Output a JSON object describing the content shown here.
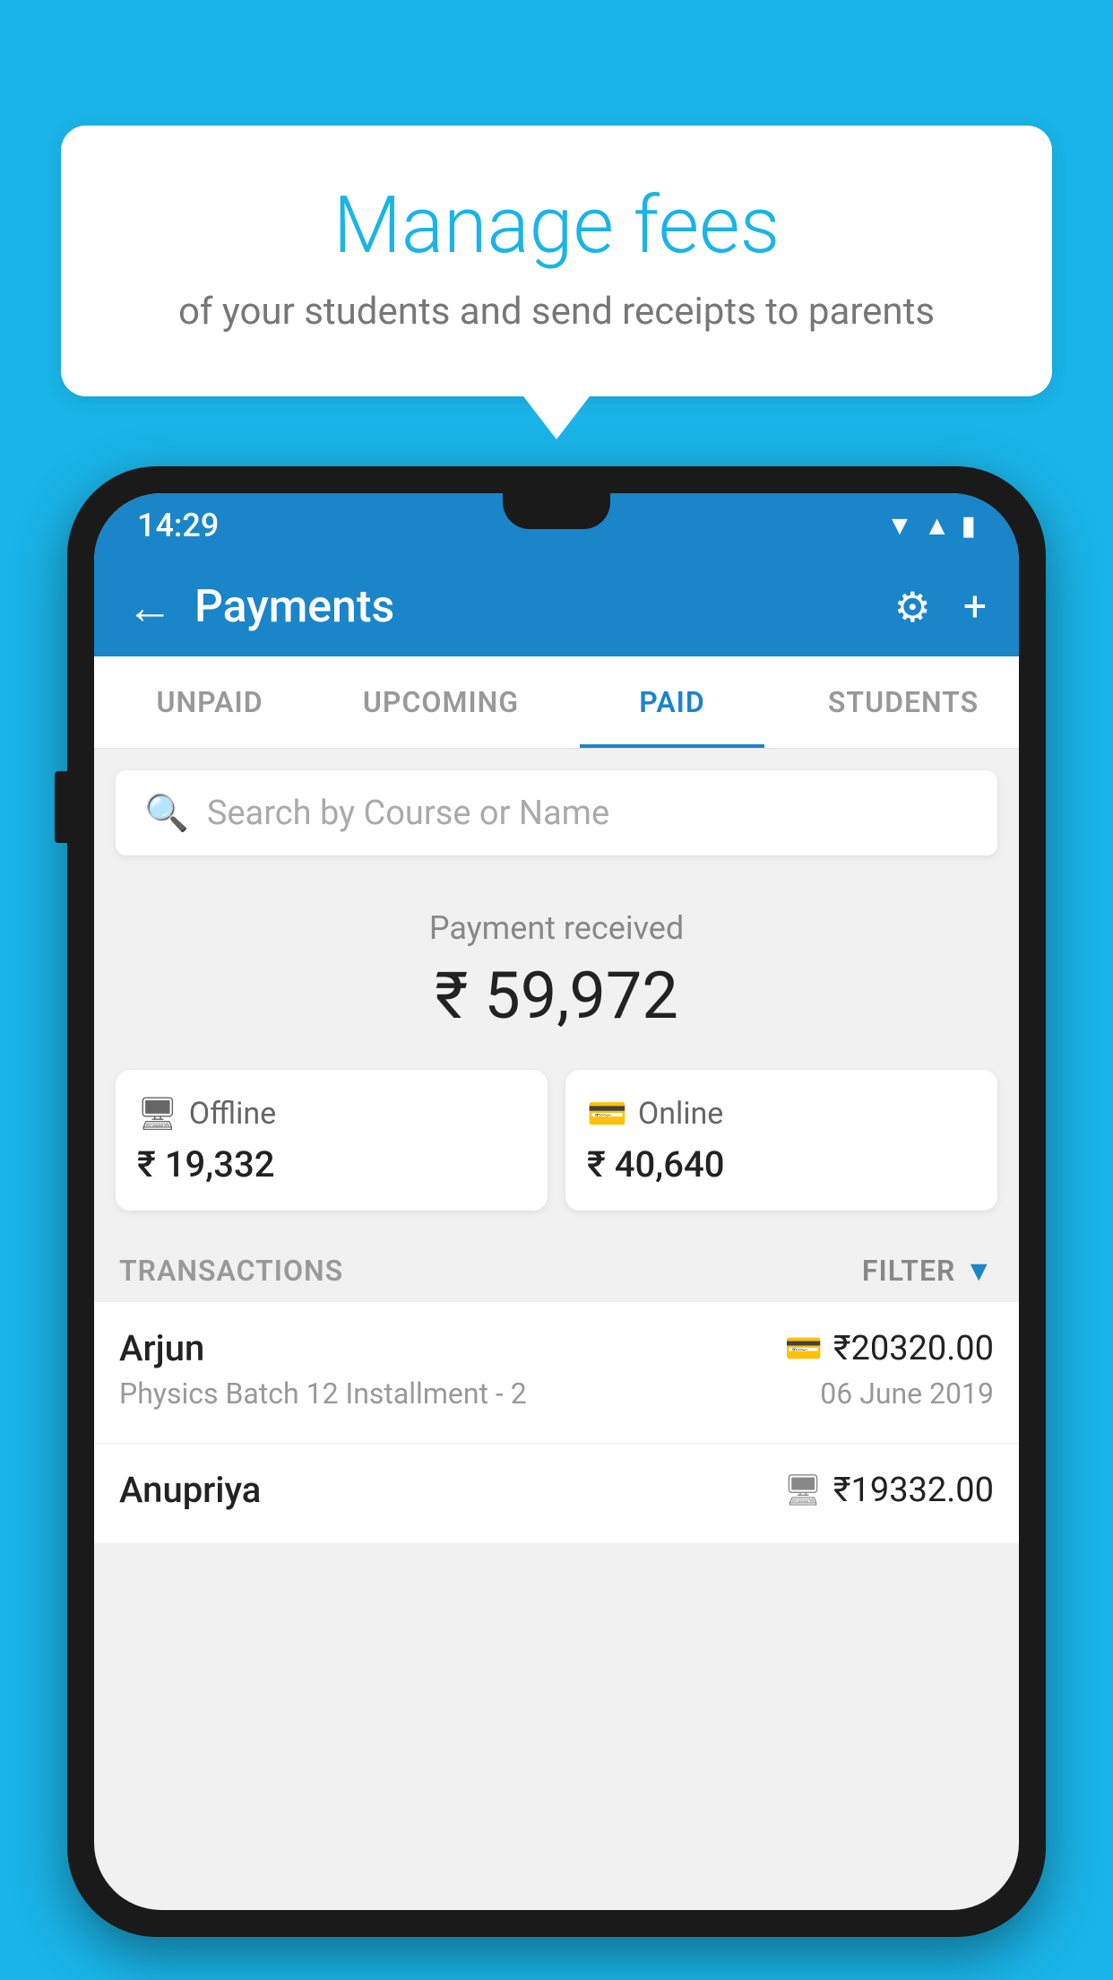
{
  "background_color": "#1ab4e8",
  "speech_bubble": {
    "title": "Manage fees",
    "subtitle": "of your students and send receipts to parents"
  },
  "status_bar": {
    "time": "14:29",
    "signal_icon": "▲",
    "wifi_icon": "▼",
    "battery_icon": "▮"
  },
  "app_bar": {
    "title": "Payments",
    "back_icon": "←",
    "settings_icon": "⚙",
    "add_icon": "+"
  },
  "tabs": [
    {
      "label": "UNPAID",
      "active": false
    },
    {
      "label": "UPCOMING",
      "active": false
    },
    {
      "label": "PAID",
      "active": true
    },
    {
      "label": "STUDENTS",
      "active": false
    }
  ],
  "search": {
    "placeholder": "Search by Course or Name"
  },
  "payment_received": {
    "label": "Payment received",
    "amount": "₹ 59,972"
  },
  "payment_cards": [
    {
      "icon": "💳",
      "label": "Offline",
      "amount": "₹ 19,332"
    },
    {
      "icon": "💳",
      "label": "Online",
      "amount": "₹ 40,640"
    }
  ],
  "transactions_section": {
    "label": "TRANSACTIONS",
    "filter_label": "FILTER"
  },
  "transactions": [
    {
      "name": "Arjun",
      "detail": "Physics Batch 12 Installment - 2",
      "amount": "₹20320.00",
      "date": "06 June 2019",
      "payment_type": "online"
    },
    {
      "name": "Anupriya",
      "detail": "",
      "amount": "₹19332.00",
      "date": "",
      "payment_type": "offline"
    }
  ]
}
